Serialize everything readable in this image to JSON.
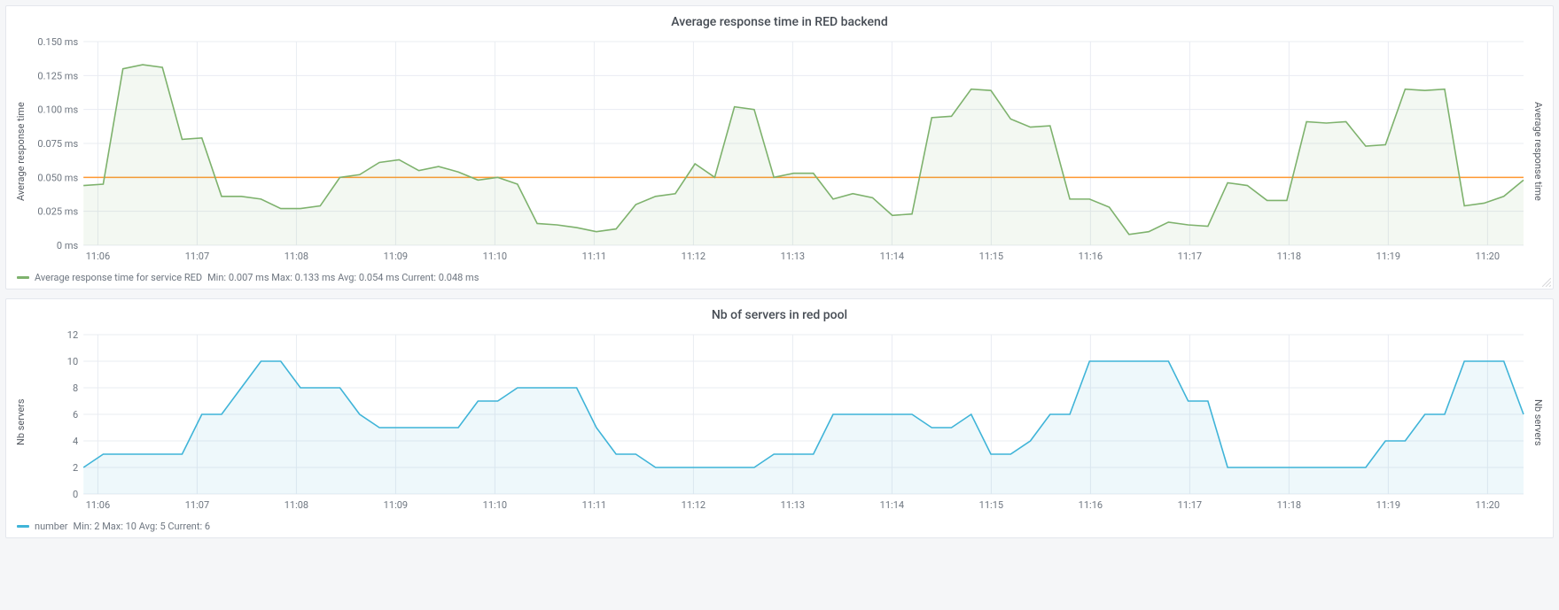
{
  "panels": [
    {
      "title": "Average response time in RED backend",
      "y_label_left": "Average response time",
      "y_label_right": "Average response time",
      "legend": {
        "color": "#7eb26d",
        "series_name": "Average response time for service RED",
        "stats": "Min: 0.007 ms  Max: 0.133 ms  Avg: 0.054 ms  Current: 0.048 ms"
      }
    },
    {
      "title": "Nb of servers in red pool",
      "y_label_left": "Nb servers",
      "y_label_right": "Nb servers",
      "legend": {
        "color": "#3fb4d8",
        "series_name": "number",
        "stats": "Min: 2  Max: 10  Avg: 5  Current: 6"
      }
    }
  ],
  "chart_data": [
    {
      "type": "line",
      "title": "Average response time in RED backend",
      "xlabel": "",
      "ylabel": "Average response time",
      "ylim": [
        0,
        0.15
      ],
      "y_ticks": [
        0,
        0.025,
        0.05,
        0.075,
        0.1,
        0.125,
        0.15
      ],
      "y_tick_labels": [
        "0 ms",
        "0.025 ms",
        "0.050 ms",
        "0.075 ms",
        "0.100 ms",
        "0.125 ms",
        "0.150 ms"
      ],
      "x_ticks": [
        "11:06",
        "11:07",
        "11:08",
        "11:09",
        "11:10",
        "11:11",
        "11:12",
        "11:13",
        "11:14",
        "11:15",
        "11:16",
        "11:17",
        "11:18",
        "11:19",
        "11:20"
      ],
      "threshold": {
        "value": 0.05,
        "color": "#ff9830"
      },
      "series": [
        {
          "name": "Average response time for service RED",
          "color": "#7eb26d",
          "fill": true,
          "x": [
            0,
            1,
            2,
            3,
            4,
            5,
            6,
            7,
            8,
            9,
            10,
            11,
            12,
            13,
            14,
            15,
            16,
            17,
            18,
            19,
            20,
            21,
            22,
            23,
            24,
            25,
            26,
            27,
            28,
            29,
            30,
            31,
            32,
            33,
            34,
            35,
            36,
            37,
            38,
            39,
            40,
            41,
            42,
            43,
            44,
            45,
            46,
            47,
            48,
            49,
            50,
            51,
            52,
            53,
            54,
            55,
            56,
            57,
            58,
            59,
            60,
            61,
            62,
            63,
            64,
            65,
            66,
            67,
            68,
            69,
            70,
            71,
            72,
            73
          ],
          "y": [
            0.044,
            0.045,
            0.13,
            0.133,
            0.131,
            0.078,
            0.079,
            0.036,
            0.036,
            0.034,
            0.027,
            0.027,
            0.029,
            0.05,
            0.052,
            0.061,
            0.063,
            0.055,
            0.058,
            0.054,
            0.048,
            0.05,
            0.045,
            0.016,
            0.015,
            0.013,
            0.01,
            0.012,
            0.03,
            0.036,
            0.038,
            0.06,
            0.05,
            0.102,
            0.1,
            0.05,
            0.053,
            0.053,
            0.034,
            0.038,
            0.035,
            0.022,
            0.023,
            0.094,
            0.095,
            0.115,
            0.114,
            0.093,
            0.087,
            0.088,
            0.034,
            0.034,
            0.028,
            0.008,
            0.01,
            0.017,
            0.015,
            0.014,
            0.046,
            0.044,
            0.033,
            0.033,
            0.091,
            0.09,
            0.091,
            0.073,
            0.074,
            0.115,
            0.114,
            0.115,
            0.029,
            0.031,
            0.036,
            0.048
          ]
        }
      ],
      "legend_position": "bottom-left",
      "grid": true
    },
    {
      "type": "line",
      "title": "Nb of servers in red pool",
      "xlabel": "",
      "ylabel": "Nb servers",
      "ylim": [
        0,
        12
      ],
      "y_ticks": [
        0,
        2,
        4,
        6,
        8,
        10,
        12
      ],
      "y_tick_labels": [
        "0",
        "2",
        "4",
        "6",
        "8",
        "10",
        "12"
      ],
      "x_ticks": [
        "11:06",
        "11:07",
        "11:08",
        "11:09",
        "11:10",
        "11:11",
        "11:12",
        "11:13",
        "11:14",
        "11:15",
        "11:16",
        "11:17",
        "11:18",
        "11:19",
        "11:20"
      ],
      "series": [
        {
          "name": "number",
          "color": "#3fb4d8",
          "fill": true,
          "x": [
            0,
            1,
            2,
            3,
            4,
            5,
            6,
            7,
            8,
            9,
            10,
            11,
            12,
            13,
            14,
            15,
            16,
            17,
            18,
            19,
            20,
            21,
            22,
            23,
            24,
            25,
            26,
            27,
            28,
            29,
            30,
            31,
            32,
            33,
            34,
            35,
            36,
            37,
            38,
            39,
            40,
            41,
            42,
            43,
            44,
            45,
            46,
            47,
            48,
            49,
            50,
            51,
            52,
            53,
            54,
            55,
            56,
            57,
            58,
            59,
            60,
            61,
            62,
            63,
            64,
            65,
            66,
            67,
            68,
            69,
            70,
            71,
            72,
            73
          ],
          "y": [
            2,
            3,
            3,
            3,
            3,
            3,
            6,
            6,
            8,
            10,
            10,
            8,
            8,
            8,
            6,
            5,
            5,
            5,
            5,
            5,
            7,
            7,
            8,
            8,
            8,
            8,
            5,
            3,
            3,
            2,
            2,
            2,
            2,
            2,
            2,
            3,
            3,
            3,
            6,
            6,
            6,
            6,
            6,
            5,
            5,
            6,
            3,
            3,
            4,
            6,
            6,
            10,
            10,
            10,
            10,
            10,
            7,
            7,
            2,
            2,
            2,
            2,
            2,
            2,
            2,
            2,
            4,
            4,
            6,
            6,
            10,
            10,
            10,
            6
          ]
        }
      ],
      "legend_position": "bottom-left",
      "grid": true
    }
  ]
}
